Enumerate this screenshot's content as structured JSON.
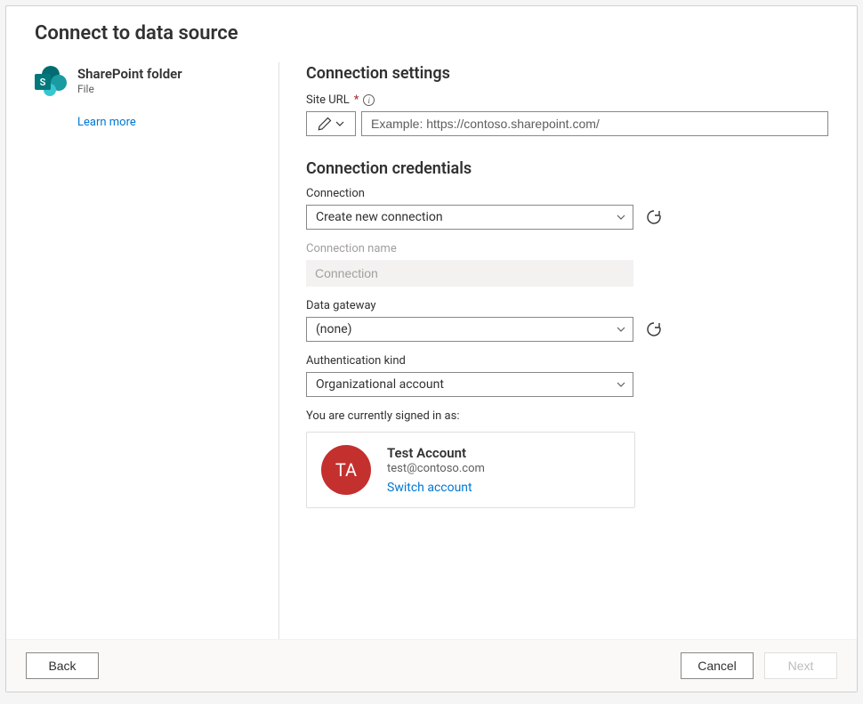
{
  "title": "Connect to data source",
  "connector": {
    "name": "SharePoint folder",
    "subtype": "File",
    "badge": "S",
    "learn_more": "Learn more"
  },
  "settings": {
    "heading": "Connection settings",
    "site_url": {
      "label": "Site URL",
      "required_mark": "*",
      "placeholder": "Example: https://contoso.sharepoint.com/"
    }
  },
  "credentials": {
    "heading": "Connection credentials",
    "connection": {
      "label": "Connection",
      "value": "Create new connection"
    },
    "connection_name": {
      "label": "Connection name",
      "value": "Connection"
    },
    "gateway": {
      "label": "Data gateway",
      "value": "(none)"
    },
    "auth_kind": {
      "label": "Authentication kind",
      "value": "Organizational account"
    },
    "signed_in_text": "You are currently signed in as:",
    "account": {
      "initials": "TA",
      "name": "Test Account",
      "email": "test@contoso.com",
      "switch": "Switch account"
    }
  },
  "footer": {
    "back": "Back",
    "cancel": "Cancel",
    "next": "Next"
  }
}
